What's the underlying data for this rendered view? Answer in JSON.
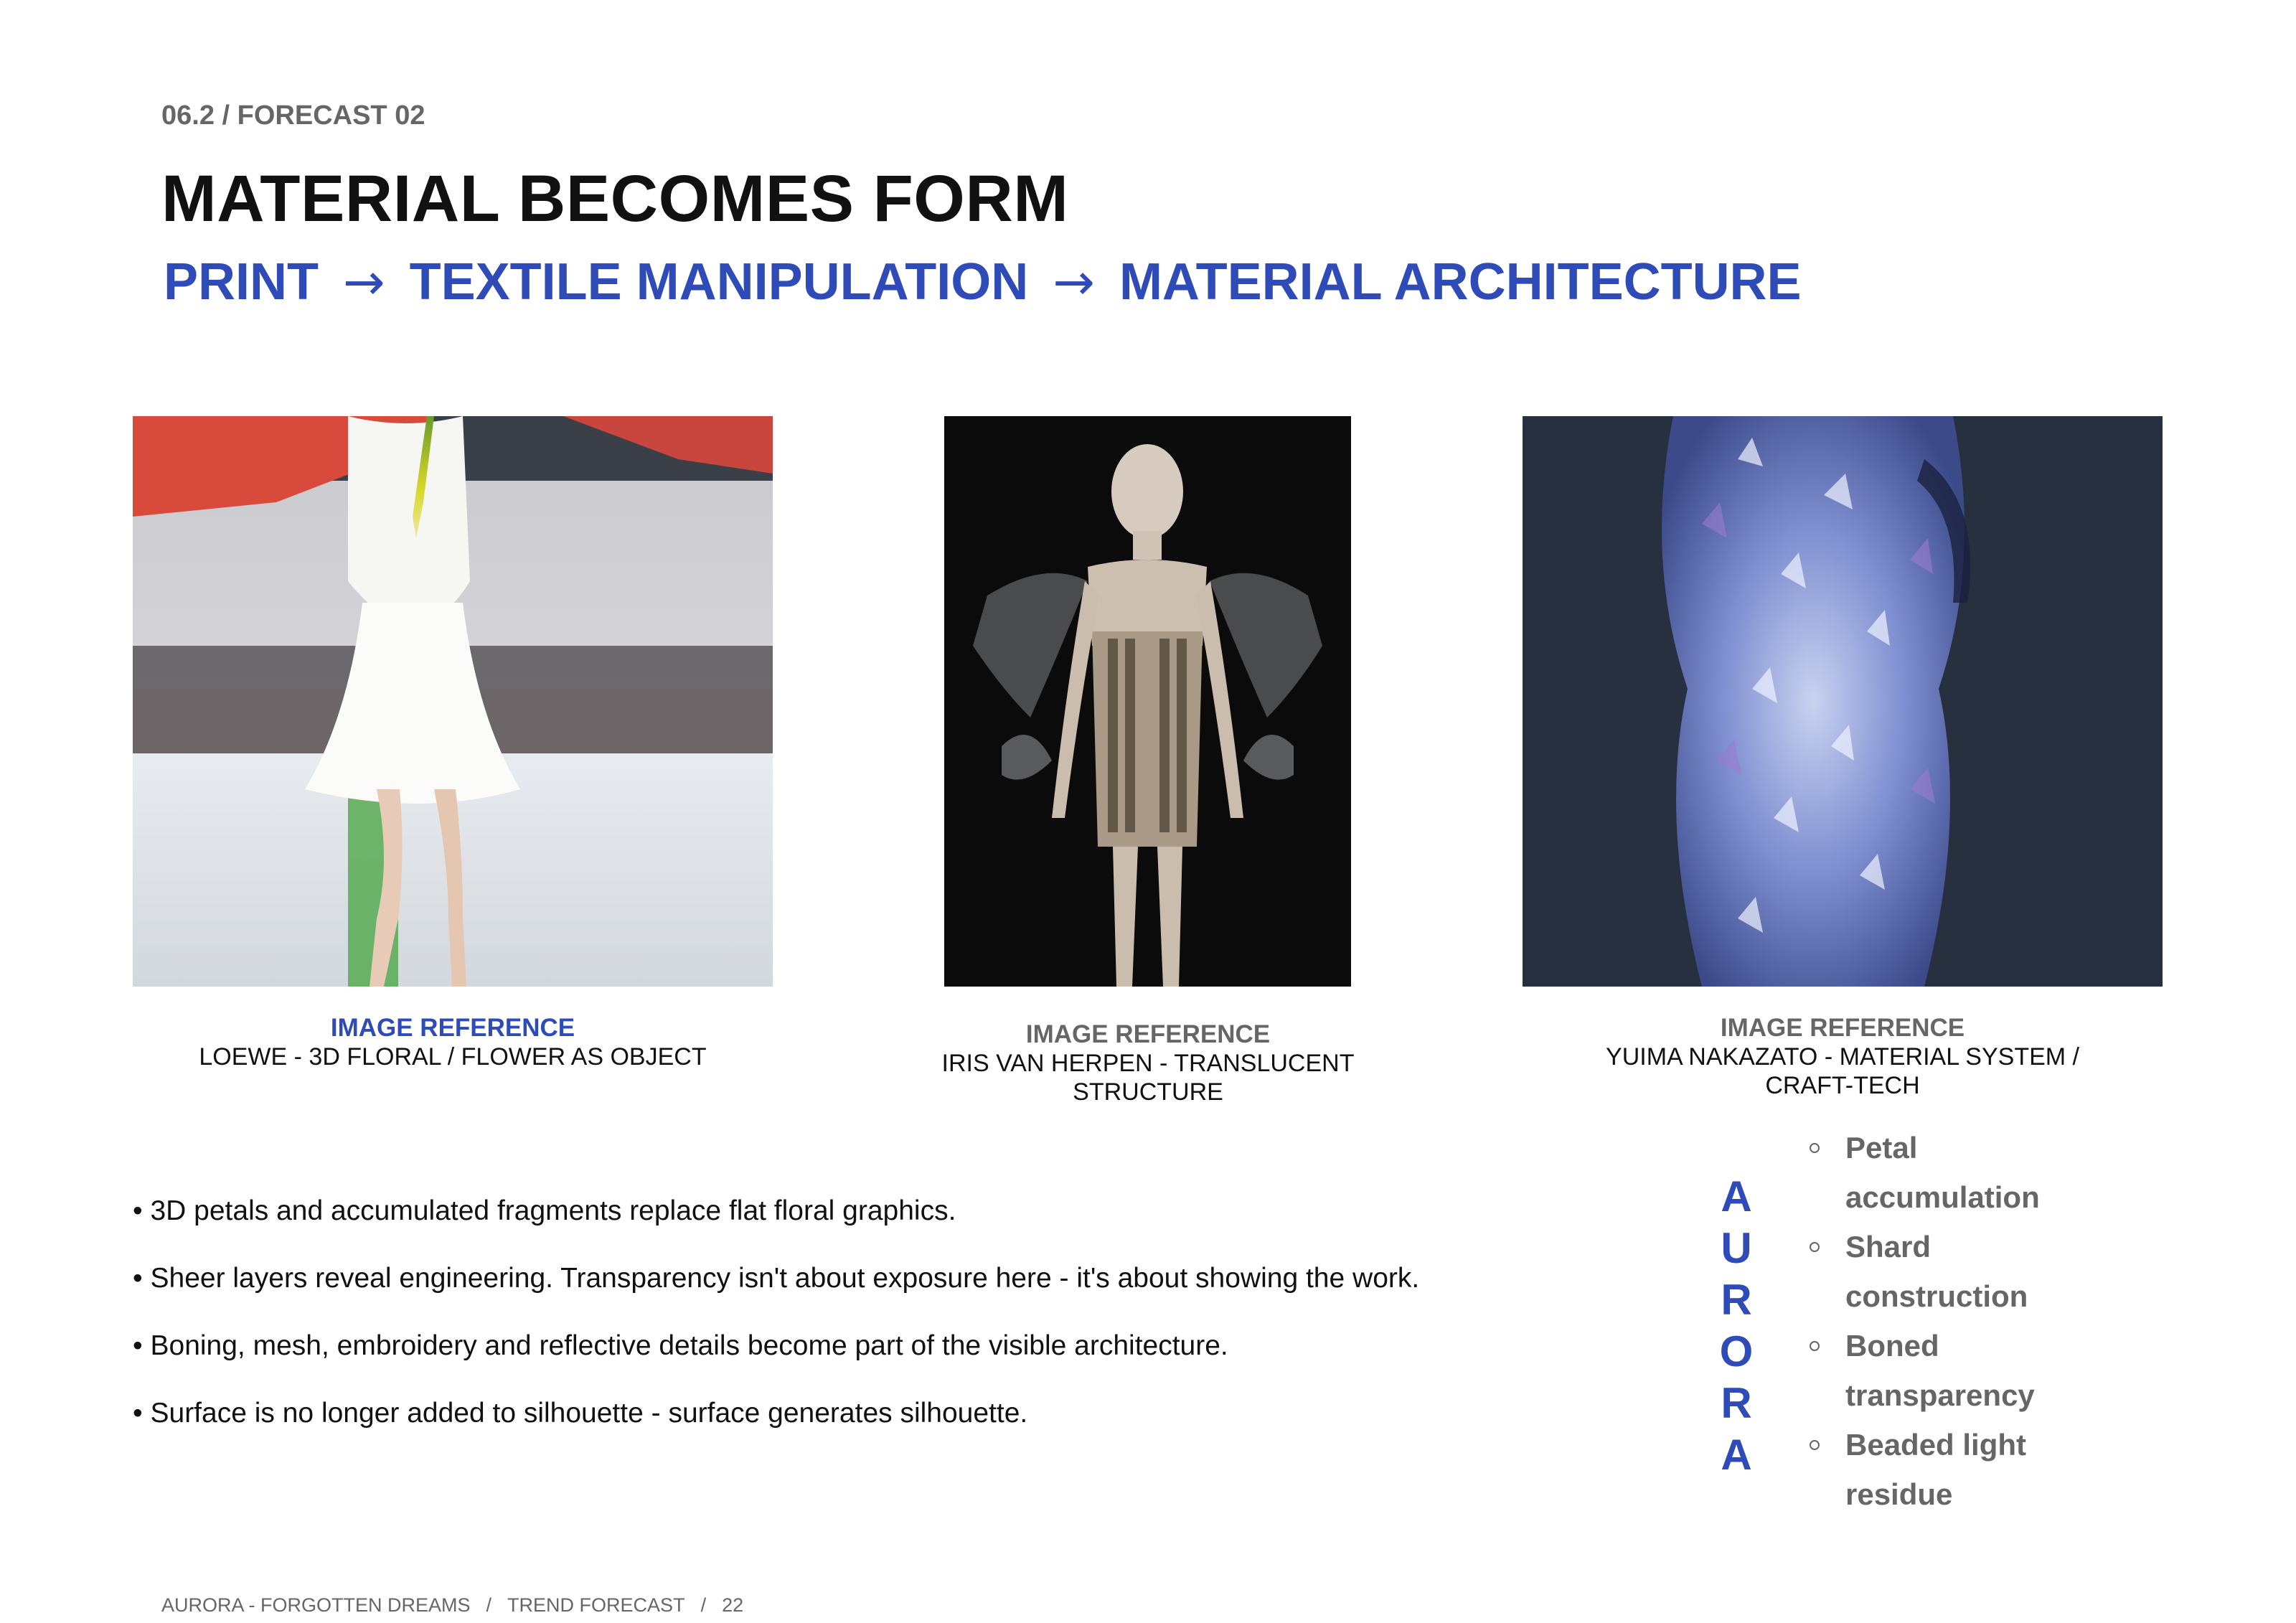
{
  "header": {
    "kicker": "06.2 / FORECAST 02",
    "title": "MATERIAL BECOMES FORM",
    "flow": {
      "step1": "PRINT",
      "step2": "TEXTILE MANIPULATION",
      "step3": "MATERIAL ARCHITECTURE",
      "arrow": "→"
    }
  },
  "references": [
    {
      "label": "IMAGE REFERENCE",
      "line1": "LOEWE - 3D FLORAL / FLOWER AS OBJECT",
      "line2": ""
    },
    {
      "label": "IMAGE REFERENCE",
      "line1": "IRIS VAN HERPEN - TRANSLUCENT",
      "line2": "STRUCTURE"
    },
    {
      "label": "IMAGE REFERENCE",
      "line1": "YUIMA NAKAZATO - MATERIAL SYSTEM /",
      "line2": "CRAFT-TECH"
    }
  ],
  "bullets": [
    "• 3D petals and accumulated fragments replace flat floral graphics.",
    "• Sheer layers reveal engineering. Transparency isn't about exposure here - it's about showing the work.",
    "• Boning, mesh, embroidery and reflective details become part of the visible architecture.",
    "• Surface is no longer added to silhouette - surface generates silhouette."
  ],
  "aurora": {
    "letters": [
      "A",
      "U",
      "R",
      "O",
      "R",
      "A"
    ],
    "items": [
      {
        "line1": "Petal",
        "line2": "accumulation"
      },
      {
        "line1": "Shard",
        "line2": "construction"
      },
      {
        "line1": "Boned",
        "line2": "transparency"
      },
      {
        "line1": "Beaded light",
        "line2": "residue"
      }
    ]
  },
  "footer": {
    "part1": "AURORA - FORGOTTEN DREAMS",
    "sep": "/",
    "part2": "TREND FORECAST",
    "page": "22"
  },
  "colors": {
    "accent": "#2e4bb8",
    "muted": "#666666",
    "text": "#111111"
  }
}
